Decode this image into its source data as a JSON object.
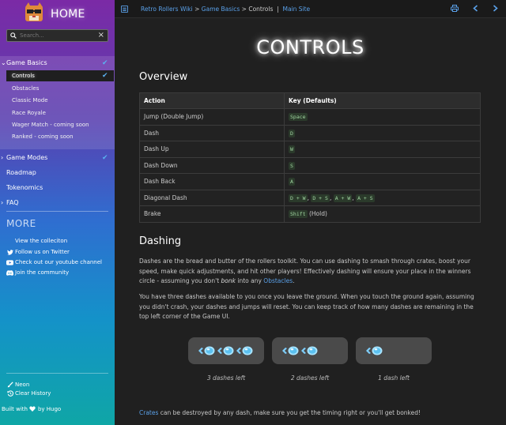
{
  "sidebar": {
    "home_title": "HOME",
    "search_placeholder": "Search...",
    "game_basics": "Game Basics",
    "basics_items": [
      "Controls",
      "Obstacles",
      "Classic Mode",
      "Race Royale",
      "Wager Match - coming soon",
      "Ranked - coming soon"
    ],
    "game_modes": "Game Modes",
    "roadmap": "Roadmap",
    "tokenomics": "Tokenomics",
    "faq": "FAQ",
    "more_title": "MORE",
    "more_links": [
      "View the colleciton",
      "Follow us on Twitter",
      "Check out our youtube channel",
      "Join the community"
    ],
    "theme_label": "Neon",
    "clear_history": "Clear History",
    "built_with_prefix": "Built with",
    "built_with_suffix": "by Hugo"
  },
  "topbar": {
    "crumb_1": "Retro Rollers Wiki",
    "crumb_sep": ">",
    "crumb_2": "Game Basics",
    "crumb_3": "Controls",
    "crumb_pipe": "|",
    "crumb_4": "Main Site"
  },
  "page": {
    "title": "CONTROLS",
    "overview_heading": "Overview",
    "table_headers": [
      "Action",
      "Key (Defaults)"
    ],
    "rows": [
      {
        "action": "Jump (Double Jump)",
        "keys": [
          "Space"
        ],
        "suffix": ""
      },
      {
        "action": "Dash",
        "keys": [
          "D"
        ],
        "suffix": ""
      },
      {
        "action": "Dash Up",
        "keys": [
          "W"
        ],
        "suffix": ""
      },
      {
        "action": "Dash Down",
        "keys": [
          "S"
        ],
        "suffix": ""
      },
      {
        "action": "Dash Back",
        "keys": [
          "A"
        ],
        "suffix": ""
      },
      {
        "action": "Diagonal Dash",
        "keys": [
          "D + W",
          "D + S",
          "A + W",
          "A + S"
        ],
        "suffix": ""
      },
      {
        "action": "Brake",
        "keys": [
          "Shift"
        ],
        "suffix": "(Hold)"
      }
    ],
    "dashing_heading": "Dashing",
    "para1_a": "Dashes are the bread and butter of the rollers toolkit. You can use dashing to smash through crates, boost your speed, make quick adjustments, and hit other players! Effectively dashing will ensure your place in the winners circle - assuming you don't ",
    "para1_bonk": "bonk",
    "para1_b": " into any ",
    "para1_link": "Obstacles",
    "para1_c": ".",
    "para2": "You have three dashes available to you once you leave the ground. When you touch the ground again, assuming you didn't crash, your dashes and jumps will reset. You can keep track of how many dashes are remaining in the top left corner of the Game UI.",
    "dash_captions": [
      "3 dashes left",
      "2 dashes left",
      "1 dash left"
    ],
    "dash_counts": [
      3,
      2,
      1
    ],
    "para3_link": "Crates",
    "para3_rest": " can be destroyed by any dash, make sure you get the timing right or you'll get bonked!"
  },
  "colors": {
    "accent_link": "#5aa0e8",
    "check": "#5ab0f0",
    "content_bg": "#202020"
  }
}
